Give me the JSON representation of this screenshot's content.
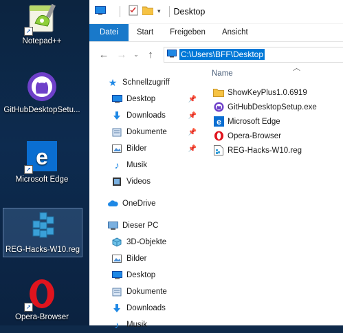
{
  "desktop": {
    "icons": [
      {
        "label": "Notepad++",
        "icon": "notepadpp-icon"
      },
      {
        "label": "GitHubDesktopSetu...",
        "icon": "github-desktop-icon"
      },
      {
        "label": "Microsoft Edge",
        "icon": "edge-icon"
      },
      {
        "label": "REG-Hacks-W10.reg",
        "icon": "reg-file-icon",
        "selected": true
      },
      {
        "label": "Opera-Browser",
        "icon": "opera-icon"
      }
    ]
  },
  "window": {
    "title": "Desktop",
    "ribbon_tabs": [
      "Datei",
      "Start",
      "Freigeben",
      "Ansicht"
    ],
    "address": "C:\\Users\\BFF\\Desktop",
    "column_name": "Name"
  },
  "nav": {
    "quick_access": "Schnellzugriff",
    "quick_items": [
      {
        "label": "Desktop",
        "icon": "desktop-folder-icon",
        "pinned": true
      },
      {
        "label": "Downloads",
        "icon": "downloads-icon",
        "pinned": true
      },
      {
        "label": "Dokumente",
        "icon": "documents-icon",
        "pinned": true
      },
      {
        "label": "Bilder",
        "icon": "pictures-icon",
        "pinned": true
      },
      {
        "label": "Musik",
        "icon": "music-icon",
        "pinned": false
      },
      {
        "label": "Videos",
        "icon": "videos-icon",
        "pinned": false
      }
    ],
    "onedrive": "OneDrive",
    "this_pc": "Dieser PC",
    "pc_items": [
      {
        "label": "3D-Objekte",
        "icon": "3d-objects-icon"
      },
      {
        "label": "Bilder",
        "icon": "pictures-icon"
      },
      {
        "label": "Desktop",
        "icon": "desktop-folder-icon"
      },
      {
        "label": "Dokumente",
        "icon": "documents-icon"
      },
      {
        "label": "Downloads",
        "icon": "downloads-icon"
      },
      {
        "label": "Musik",
        "icon": "music-icon"
      }
    ]
  },
  "files": [
    {
      "name": "ShowKeyPlus1.0.6919",
      "icon": "folder-icon"
    },
    {
      "name": "GitHubDesktopSetup.exe",
      "icon": "github-desktop-icon"
    },
    {
      "name": "Microsoft Edge",
      "icon": "edge-icon"
    },
    {
      "name": "Opera-Browser",
      "icon": "opera-icon"
    },
    {
      "name": "REG-Hacks-W10.reg",
      "icon": "reg-file-icon"
    }
  ],
  "colors": {
    "accent": "#1979ca",
    "selection": "#0078d7",
    "desktop_bg": "#0f2a4a"
  }
}
